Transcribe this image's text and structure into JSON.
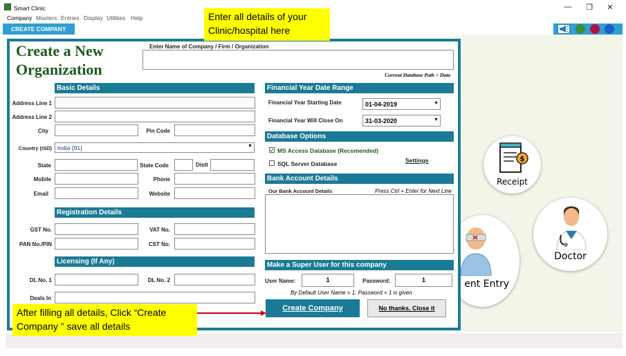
{
  "window": {
    "title": "Smart Clinic",
    "controls": [
      "—",
      "❐",
      "✕"
    ]
  },
  "menu": [
    "Company",
    "Masters",
    "Entries",
    "Display",
    "Utilities",
    "Help"
  ],
  "tab": {
    "label": "CREATE COMPANY"
  },
  "header": {
    "title_line1": "Create a New",
    "title_line2": "Organization",
    "company_name_label": "Enter Name of Company / Firm / Organization",
    "company_name_value": "",
    "db_path": "Current Database Path = Data"
  },
  "basic": {
    "section": "Basic Details",
    "address1_label": "Address Line 1",
    "address2_label": "Address Line 2",
    "city_label": "City",
    "pin_label": "Pin Code",
    "country_label": "Country (ISD)",
    "country_value": "India  {91}",
    "state_label": "State",
    "state_code_label": "State Code",
    "distt_label": "Distt",
    "mobile_label": "Mobile",
    "phone_label": "Phone",
    "email_label": "Email",
    "website_label": "Website"
  },
  "registration": {
    "section": "Registration Details",
    "gst_label": "GST No.",
    "vat_label": "VAT No.",
    "pan_label": "PAN No./PIN",
    "cst_label": "CST No."
  },
  "licensing": {
    "section": "Licensing (If Any)",
    "dl1_label": "DL No. 1",
    "dl2_label": "DL No. 2",
    "deals_label": "Deals In"
  },
  "financial": {
    "section": "Financial Year Date Range",
    "start_label": "Financial Year Starting Date",
    "start_value": "01-04-2019",
    "end_label": "Financial Year Will Close On",
    "end_value": "31-03-2020"
  },
  "database": {
    "section": "Database Options",
    "ms_access": "MS Access Database   (Recomended)",
    "ms_access_checked": "✓",
    "sql_server": "SQL Server Database",
    "settings": "Settings"
  },
  "bank": {
    "section": "Bank Account Details",
    "label": "Our Bank Account Details",
    "hint": "Press Ctrl + Enter for Next Line"
  },
  "superuser": {
    "section": "Make a Super User for this company",
    "user_label": "User Name:",
    "user_value": "1",
    "password_label": "Password:",
    "password_value": "1",
    "default_note": "By Default User Name = 1,  Password = 1 is given"
  },
  "buttons": {
    "create": "Create Company",
    "cancel": "No thanks, Close it"
  },
  "callouts": {
    "top": "Enter all details of your Clinic/hospital here",
    "bottom": "After filling all details, Click “Create Company ” save all details"
  },
  "shortcuts": {
    "receipt": "Receipt",
    "doctor": "Doctor",
    "patient": "ent Entry"
  },
  "colors": {
    "accent": "#1b7a96",
    "tab": "#2e9fd4",
    "title_green": "#1b5a1b",
    "callout": "#ffff00",
    "arrow": "#cc0000"
  }
}
